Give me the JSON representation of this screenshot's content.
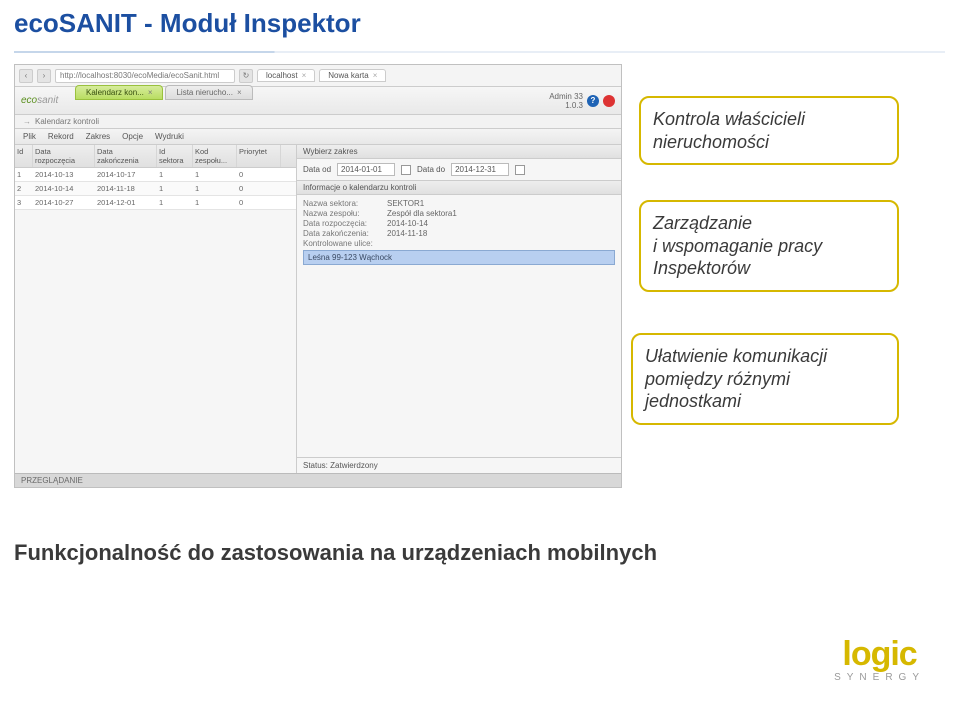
{
  "slide": {
    "title": "ecoSANIT - Moduł Inspektor",
    "bottom_text": "Funkcjonalność do zastosowania na urządzeniach mobilnych"
  },
  "browser": {
    "url": "http://localhost:8030/ecoMedia/ecoSanit.html",
    "tab1": "localhost",
    "tab2": "Nowa karta"
  },
  "app": {
    "logo_eco": "eco",
    "logo_sanit": "sanit",
    "tab_active": "Kalendarz kon...",
    "tab_inactive": "Lista nierucho...",
    "user": "Admin 33",
    "version": "1.0.3",
    "breadcrumb": "Kalendarz kontroli",
    "menu": {
      "plik": "Plik",
      "rekord": "Rekord",
      "zakres": "Zakres",
      "opcje": "Opcje",
      "wydruki": "Wydruki"
    }
  },
  "table": {
    "cols": {
      "id": "Id",
      "start": "Data rozpoczęcia",
      "end": "Data zakończenia",
      "sektor": "Id sektora",
      "zespol": "Kod zespołu...",
      "priorytet": "Priorytet"
    },
    "rows": [
      {
        "id": "1",
        "start": "2014-10-13",
        "end": "2014-10-17",
        "sektor": "1",
        "zespol": "1",
        "priorytet": "0"
      },
      {
        "id": "2",
        "start": "2014-10-14",
        "end": "2014-11-18",
        "sektor": "1",
        "zespol": "1",
        "priorytet": "0"
      },
      {
        "id": "3",
        "start": "2014-10-27",
        "end": "2014-12-01",
        "sektor": "1",
        "zespol": "1",
        "priorytet": "0"
      }
    ]
  },
  "filter": {
    "title": "Wybierz zakres",
    "from_label": "Data od",
    "from": "2014-01-01",
    "to_label": "Data do",
    "to": "2014-12-31"
  },
  "info": {
    "title": "Informacje o kalendarzu kontroli",
    "sector_k": "Nazwa sektora:",
    "sector_v": "SEKTOR1",
    "team_k": "Nazwa zespołu:",
    "team_v": "Zespół dla sektora1",
    "start_k": "Data rozpoczęcia:",
    "start_v": "2014-10-14",
    "end_k": "Data zakończenia:",
    "end_v": "2014-11-18",
    "streets_k": "Kontrolowane ulice:",
    "street_row": "Leśna 99-123 Wąchock"
  },
  "status": {
    "label": "Status:",
    "value": "Zatwierdzony"
  },
  "footer": {
    "mode": "PRZEGLĄDANIE"
  },
  "callouts": {
    "c1": "Kontrola właścicieli nieruchomości",
    "c2": "Zarządzanie\ni wspomaganie pracy Inspektorów",
    "c3": "Ułatwienie komunikacji pomiędzy różnymi jednostkami"
  },
  "logo": {
    "word": "logic",
    "sub": "SYNERGY"
  }
}
